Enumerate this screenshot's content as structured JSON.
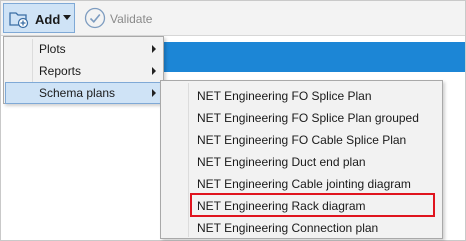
{
  "toolbar": {
    "add_label": "Add",
    "validate_label": "Validate"
  },
  "add_menu": {
    "items": [
      {
        "label": "Plots",
        "has_submenu": true
      },
      {
        "label": "Reports",
        "has_submenu": true
      },
      {
        "label": "Schema plans",
        "has_submenu": true,
        "active": true
      }
    ]
  },
  "schema_plans_menu": {
    "items": [
      {
        "label": "NET Engineering FO Splice Plan"
      },
      {
        "label": "NET Engineering FO Splice Plan grouped"
      },
      {
        "label": "NET Engineering FO Cable Splice Plan"
      },
      {
        "label": "NET Engineering Duct end plan"
      },
      {
        "label": "NET Engineering Cable jointing diagram"
      },
      {
        "label": "NET Engineering Rack diagram",
        "highlighted": true
      },
      {
        "label": "NET Engineering Connection plan"
      }
    ]
  },
  "colors": {
    "accent_blue": "#1c86d6",
    "highlight_red": "#e0141e",
    "hover_bg": "#cfe3f6"
  }
}
